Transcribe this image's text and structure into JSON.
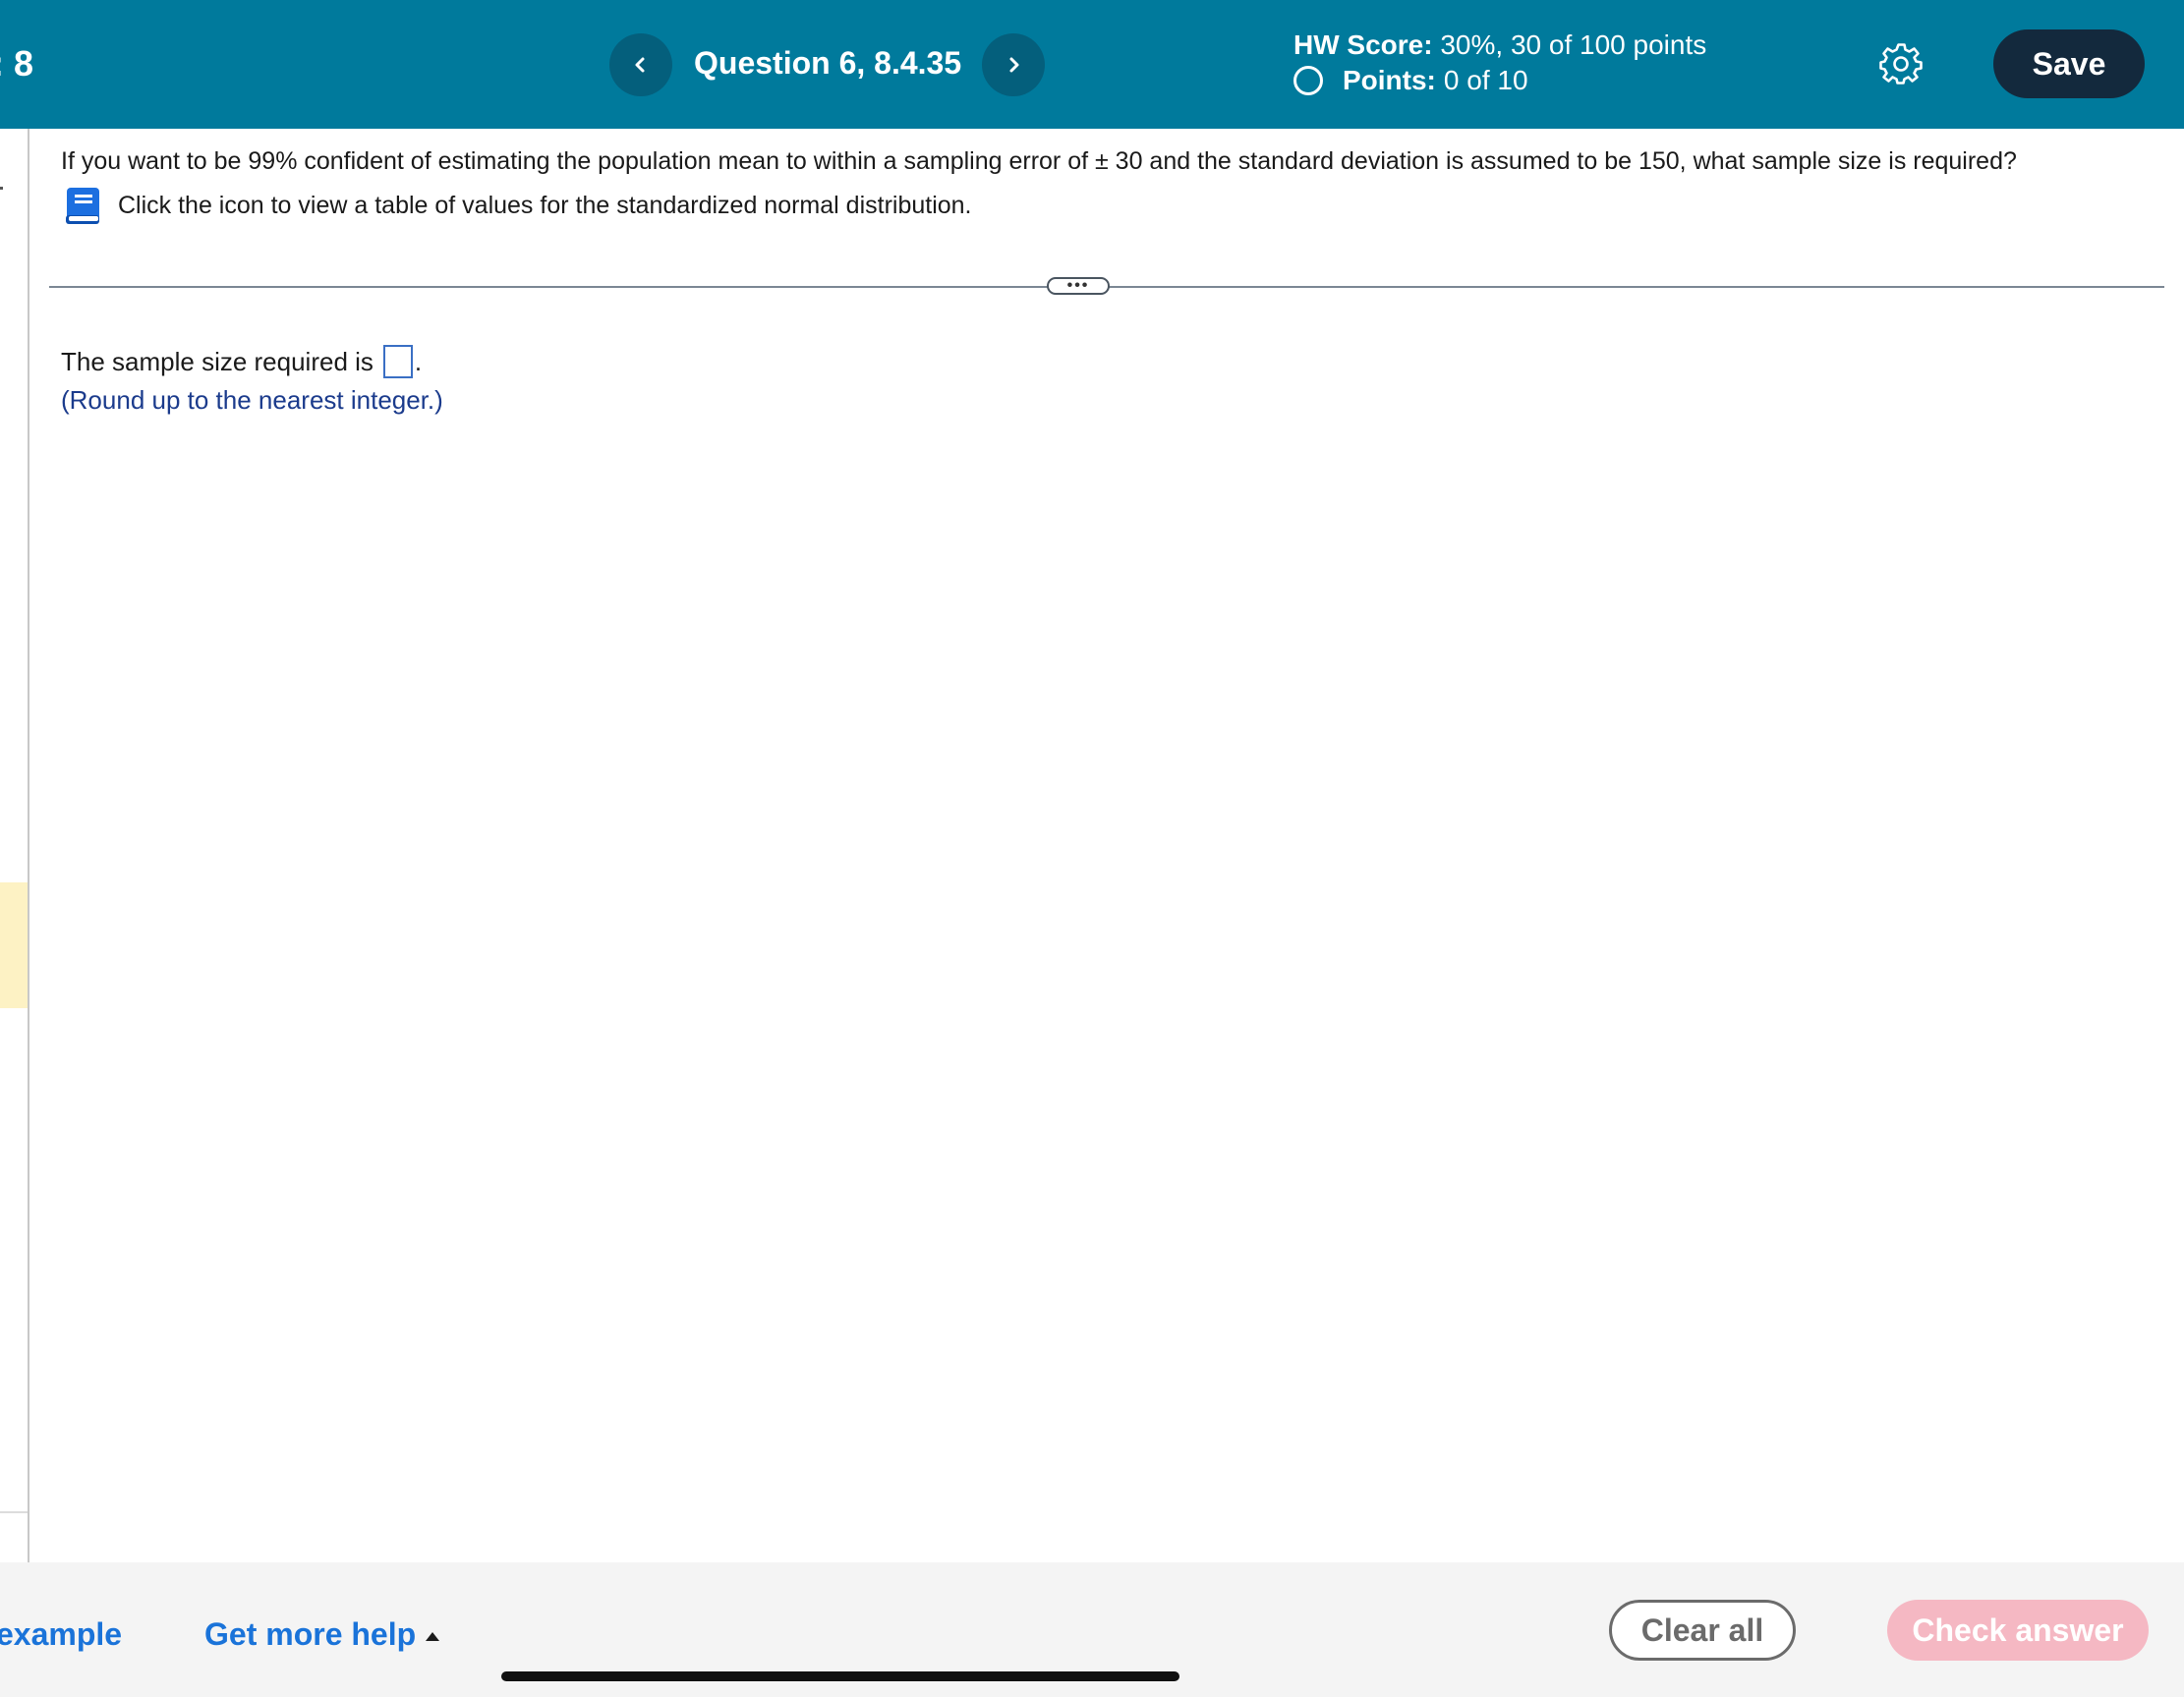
{
  "header": {
    "left_fragment": ": 8",
    "question_title": "Question 6, 8.4.35",
    "hw_score_label": "HW Score:",
    "hw_score_value": "30%, 30 of 100 points",
    "points_label": "Points:",
    "points_value": "0 of 10",
    "save_label": "Save"
  },
  "question": {
    "text": "If you want to be 99% confident of estimating the population mean to within a sampling error of ± 30 and the standard deviation is assumed to be 150, what sample size is required?",
    "table_hint": "Click the icon to view a table of values for the standardized normal distribution."
  },
  "divider": {
    "pill_label": "•••"
  },
  "answer": {
    "prefix": "The sample size required is",
    "suffix": ".",
    "input_value": "",
    "hint": "(Round up to the nearest integer.)"
  },
  "footer": {
    "example_label": "example",
    "help_label": "Get more help",
    "clear_label": "Clear all",
    "check_label": "Check answer"
  },
  "colors": {
    "header_bg": "#007a9c",
    "nav_button_bg": "#045f7c",
    "save_button_bg": "#13293d",
    "link_blue": "#1a73d9",
    "hint_blue": "#1b3b8c",
    "check_answer_disabled": "#f5b8c3",
    "left_highlight": "#fdf2c4"
  },
  "icons": [
    "chevron-left-icon",
    "chevron-right-icon",
    "status-circle-icon",
    "gear-icon",
    "book-icon",
    "caret-up-icon"
  ]
}
